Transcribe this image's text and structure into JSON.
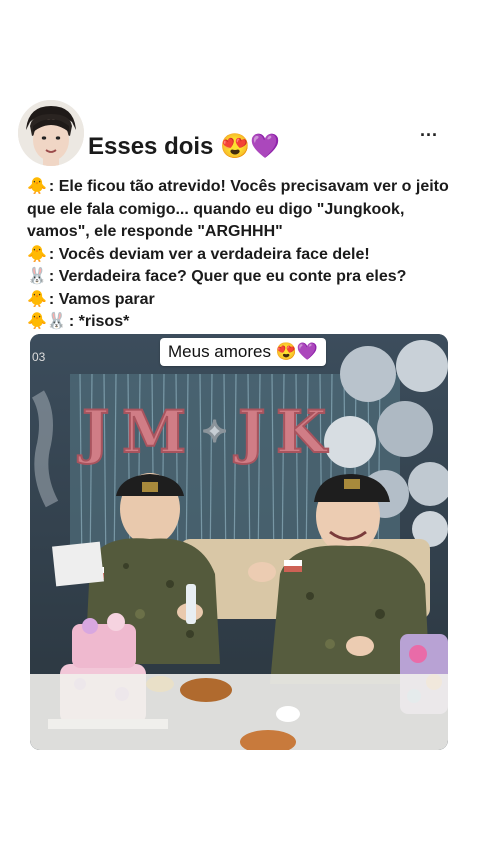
{
  "post": {
    "author": "Esses dois 😍💜",
    "more": "..."
  },
  "lines": [
    {
      "prefix": "🐥",
      "text": ": Ele ficou tão atrevido! Vocês precisavam ver o jeito que ele fala comigo... quando eu digo \"Jungkook, vamos\", ele responde \"ARGHHH\""
    },
    {
      "prefix": "🐥",
      "text": ": Vocês deviam ver a verdadeira face dele!"
    },
    {
      "prefix": "🐰",
      "text": ": Verdadeira face? Quer que eu conte pra eles?"
    },
    {
      "prefix": "🐥",
      "text": ": Vamos parar"
    },
    {
      "prefix": "🐥🐰",
      "text": ": *risos*"
    }
  ],
  "photo": {
    "caption": "Meus amores 😍💜",
    "counter": "03",
    "banner": "JM ✦ JK"
  },
  "colors": {
    "background": "#ffffff",
    "text": "#1b1b1b"
  }
}
